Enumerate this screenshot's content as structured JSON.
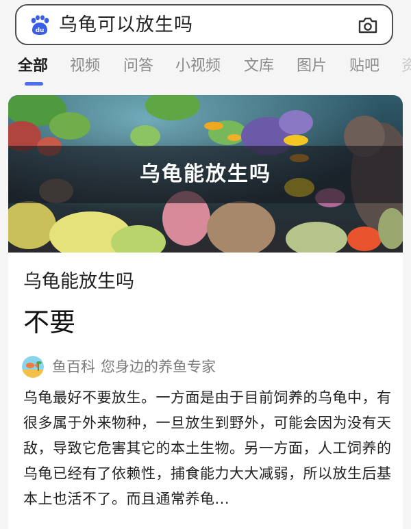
{
  "search": {
    "query": "乌龟可以放生吗"
  },
  "icons": {
    "logo": "baidu-paw-logo",
    "camera": "camera-icon"
  },
  "tabs": [
    {
      "label": "全部",
      "active": true
    },
    {
      "label": "视频",
      "active": false
    },
    {
      "label": "问答",
      "active": false
    },
    {
      "label": "小视频",
      "active": false
    },
    {
      "label": "文库",
      "active": false
    },
    {
      "label": "图片",
      "active": false
    },
    {
      "label": "贴吧",
      "active": false
    },
    {
      "label": "资",
      "active": false
    }
  ],
  "result": {
    "hero_title": "乌龟能放生吗",
    "subtitle": "乌龟能放生吗",
    "answer": "不要",
    "source_name": "鱼百科",
    "source_desc": "您身边的养鱼专家",
    "abstract": "乌龟最好不要放生。一方面是由于目前饲养的乌龟中，有很多属于外来物种，一旦放生到野外，可能会因为没有天敌，导致它危害其它的本土生物。另一方面，人工饲养的乌龟已经有了依赖性，捕食能力大大减弱，所以放生后基本上也活不了。而且通常养龟..."
  },
  "colors": {
    "accent": "#4e6ef2",
    "text_primary": "#222222",
    "text_secondary": "#8a8a8a",
    "background": "#f5f5f6"
  }
}
